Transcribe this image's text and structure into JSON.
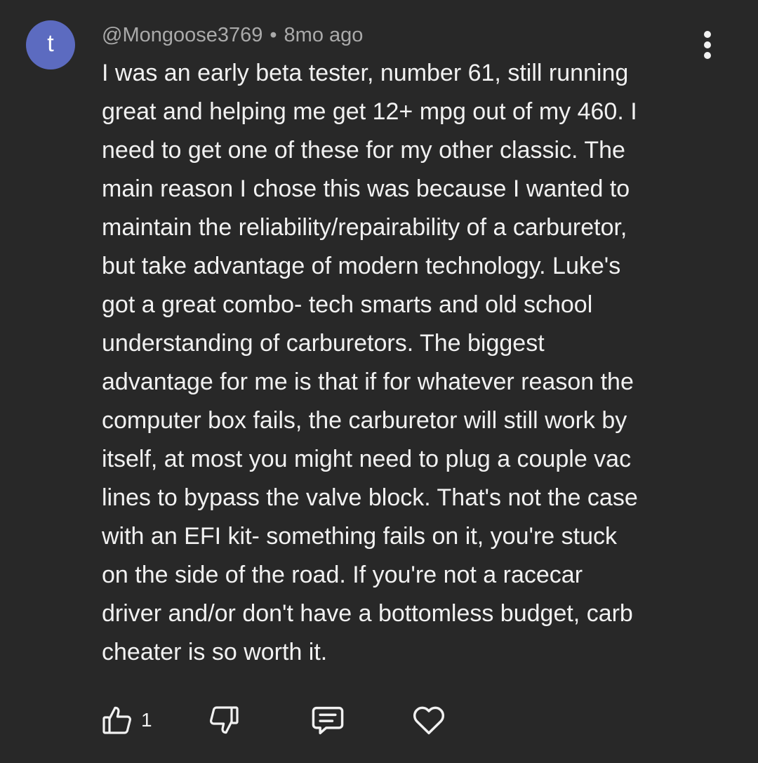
{
  "comment": {
    "avatar_letter": "t",
    "author": "@Mongoose3769",
    "separator": "•",
    "timestamp": "8mo ago",
    "text_lines": [
      "I was an early beta tester, number 61, still running",
      "great and helping me get 12+ mpg out of my 460. I",
      "need to get one of these for my other classic. The",
      "main reason I chose this was because I wanted to",
      "maintain the reliability/repairability of a carburetor,",
      "but take advantage of modern technology. Luke's",
      "got a great combo- tech smarts and old school",
      "understanding of carburetors. The biggest",
      "advantage for me is that if for whatever reason the",
      "computer box fails, the carburetor will still work by",
      "itself, at most you might need to plug a couple vac",
      "lines to bypass the valve block. That's not the case",
      "with an EFI kit- something fails on it, you're stuck",
      "on the side of the road. If you're not a racecar",
      "driver and/or don't have a bottomless budget, carb",
      "cheater is so worth it."
    ],
    "like_count": "1"
  },
  "icons": {
    "menu": "more-vertical-icon",
    "like": "thumbs-up-icon",
    "dislike": "thumbs-down-icon",
    "reply": "reply-comment-icon",
    "heart": "heart-icon"
  },
  "colors": {
    "background": "#282828",
    "avatar": "#5c6bc0",
    "text": "#f1f1f1",
    "meta_text": "#aaaaaa"
  }
}
